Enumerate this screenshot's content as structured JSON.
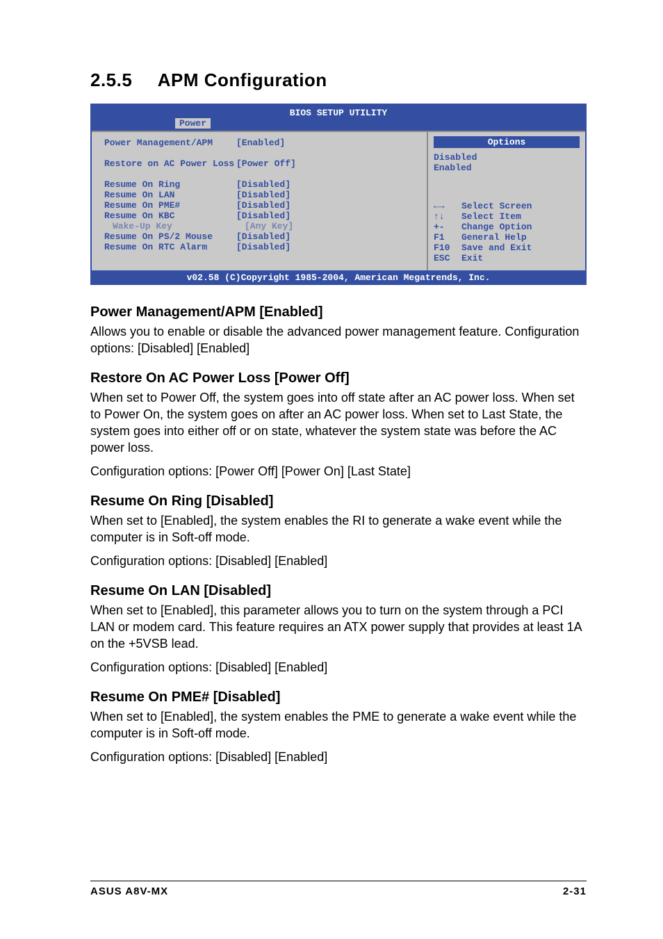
{
  "title_num": "2.5.5",
  "title_text": "APM Configuration",
  "bios": {
    "header": "BIOS SETUP UTILITY",
    "tab": "Power",
    "settings": [
      {
        "label": "Power Management/APM",
        "value": "[Enabled]",
        "dim": false,
        "indent": 0,
        "spaceAfter": true
      },
      {
        "label": "Restore on AC Power Loss",
        "value": "[Power Off]",
        "dim": false,
        "indent": 0,
        "spaceAfter": true
      },
      {
        "label": "Resume On Ring",
        "value": "[Disabled]",
        "dim": false,
        "indent": 0
      },
      {
        "label": "Resume On LAN",
        "value": "[Disabled]",
        "dim": false,
        "indent": 0
      },
      {
        "label": "Resume On PME#",
        "value": "[Disabled]",
        "dim": false,
        "indent": 0
      },
      {
        "label": "Resume On KBC",
        "value": "[Disabled]",
        "dim": false,
        "indent": 0
      },
      {
        "label": "Wake-Up Key",
        "value": "[Any Key]",
        "dim": true,
        "indent": 1
      },
      {
        "label": "Resume On PS/2 Mouse",
        "value": "[Disabled]",
        "dim": false,
        "indent": 0
      },
      {
        "label": "Resume On RTC Alarm",
        "value": "[Disabled]",
        "dim": false,
        "indent": 0
      }
    ],
    "options_head": "Options",
    "options": [
      "Disabled",
      "Enabled"
    ],
    "hints": [
      {
        "key": "←→",
        "label": "Select Screen"
      },
      {
        "key": "↑↓",
        "label": "Select Item"
      },
      {
        "key": "+-",
        "label": "Change Option"
      },
      {
        "key": "F1",
        "label": "General Help"
      },
      {
        "key": "F10",
        "label": "Save and Exit"
      },
      {
        "key": "ESC",
        "label": "Exit"
      }
    ],
    "footer": "v02.58 (C)Copyright 1985-2004, American Megatrends, Inc."
  },
  "sections": [
    {
      "head": "Power Management/APM [Enabled]",
      "paras": [
        "Allows you to enable or disable the advanced power management feature. Configuration options: [Disabled] [Enabled]"
      ]
    },
    {
      "head": "Restore On AC Power Loss [Power Off]",
      "paras": [
        "When set to Power Off, the system goes into off state after an AC power loss. When set to Power On, the system goes on after an AC power loss. When set to Last State, the system goes into either off or on state, whatever the system state was before the AC power loss.",
        "Configuration options: [Power Off] [Power On] [Last State]"
      ]
    },
    {
      "head": "Resume On Ring [Disabled]",
      "paras": [
        "When set to [Enabled], the system enables the RI to generate a wake event while the computer is in Soft-off mode.",
        "Configuration options: [Disabled] [Enabled]"
      ]
    },
    {
      "head": "Resume On LAN [Disabled]",
      "paras": [
        "When set to [Enabled], this parameter allows you to turn on the system through a PCI LAN or modem card. This feature requires an ATX power supply that provides at least 1A on the +5VSB lead.",
        "Configuration options: [Disabled] [Enabled]"
      ]
    },
    {
      "head": "Resume On PME# [Disabled]",
      "paras": [
        "When set to [Enabled], the system enables the PME to generate a wake event while the computer is in Soft-off mode.",
        "Configuration options: [Disabled] [Enabled]"
      ]
    }
  ],
  "footer_left": "ASUS A8V-MX",
  "footer_right": "2-31"
}
